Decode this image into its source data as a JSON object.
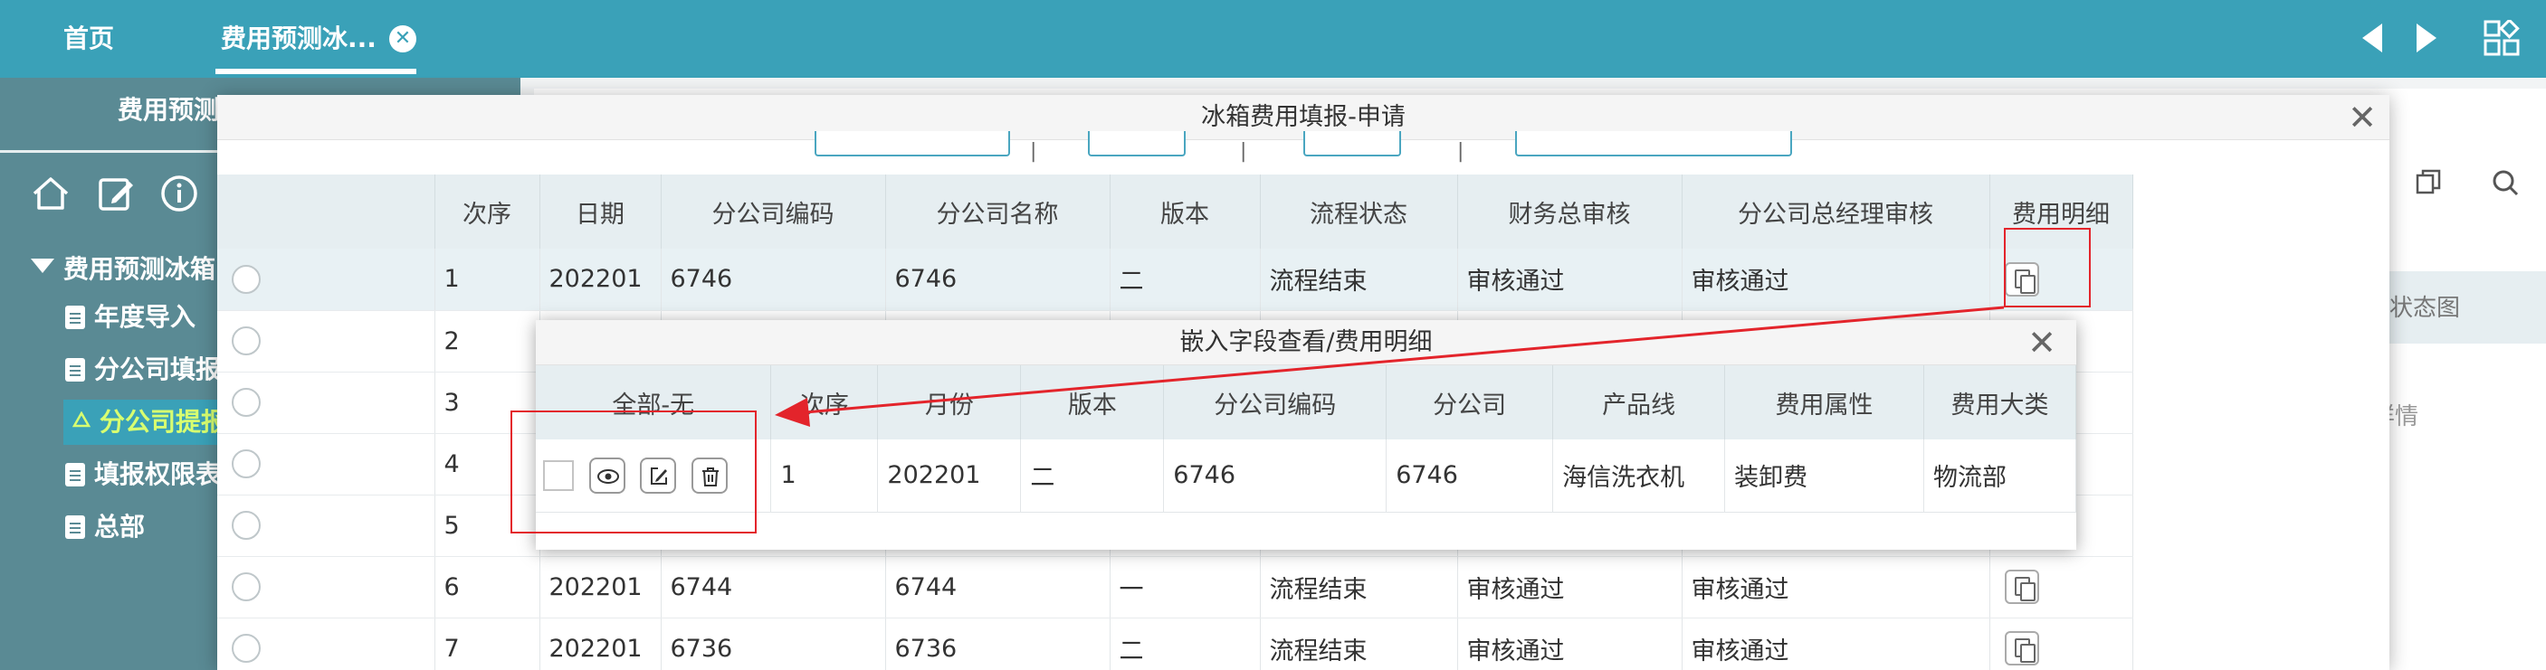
{
  "tabs": {
    "home": "首页",
    "active": "费用预测冰...",
    "close_glyph": "✕"
  },
  "sidebar": {
    "title": "费用预测",
    "tree_root": "费用预测冰箱",
    "items": [
      "年度导入",
      "分公司填报",
      "分公司提报",
      "填报权限表",
      "总部"
    ]
  },
  "background_panel": {
    "header_text": "状态图",
    "detail_text": "详情"
  },
  "dialog": {
    "title": "冰箱费用填报-申请",
    "close_glyph": "✕",
    "columns": [
      "次序",
      "日期",
      "分公司编码",
      "分公司名称",
      "版本",
      "流程状态",
      "财务总审核",
      "分公司总经理审核",
      "费用明细"
    ],
    "rows": [
      {
        "seq": "1",
        "date": "202201",
        "code": "6746",
        "name": "6746",
        "version": "二",
        "status": "流程结束",
        "finance": "审核通过",
        "gm": "审核通过"
      },
      {
        "seq": "2"
      },
      {
        "seq": "3"
      },
      {
        "seq": "4"
      },
      {
        "seq": "5"
      },
      {
        "seq": "6",
        "date": "202201",
        "code": "6744",
        "name": "6744",
        "version": "一",
        "status": "流程结束",
        "finance": "审核通过",
        "gm": "审核通过"
      },
      {
        "seq": "7",
        "date": "202201",
        "code": "6736",
        "name": "6736",
        "version": "二",
        "status": "流程结束",
        "finance": "审核通过",
        "gm": "审核通过"
      }
    ]
  },
  "subdialog": {
    "title": "嵌入字段查看/费用明细",
    "close_glyph": "✕",
    "columns": [
      "全部-无",
      "次序",
      "月份",
      "版本",
      "分公司编码",
      "分公司",
      "产品线",
      "费用属性",
      "费用大类"
    ],
    "row": {
      "seq": "1",
      "month": "202201",
      "version": "二",
      "code": "6746",
      "company": "6746",
      "product_line": "海信洗衣机",
      "fee_attr": "装卸费",
      "fee_category": "物流部"
    }
  },
  "colors": {
    "topbar": "#3aa1b8",
    "sidebar": "#5a8a94",
    "highlight": "#e3242b",
    "active_item_text": "#d8ff70"
  }
}
